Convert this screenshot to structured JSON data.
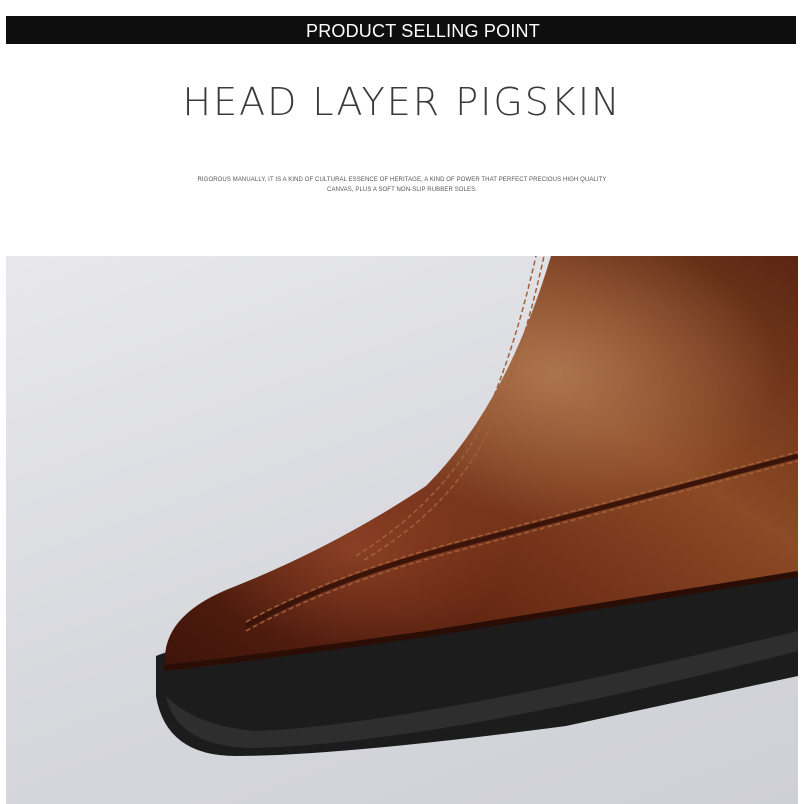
{
  "header": {
    "title": "PRODUCT SELLING POINT"
  },
  "main": {
    "title": "HEAD LAYER PIGSKIN",
    "description_line1": "RIGOROUS MANUALLY, IT IS A KIND OF CULTURAL ESSENCE OF HERITAGE, A KIND OF POWER THAT PERFECT PRECIOUS HIGH QUALITY",
    "description_line2": "CANVAS, PLUS A SOFT NON-SLIP RUBBER SOLES."
  },
  "colors": {
    "header_bg": "#0e0e0e",
    "leather": "#6b2a16",
    "sole": "#1c1c1c",
    "background": "#d7d8dd"
  }
}
